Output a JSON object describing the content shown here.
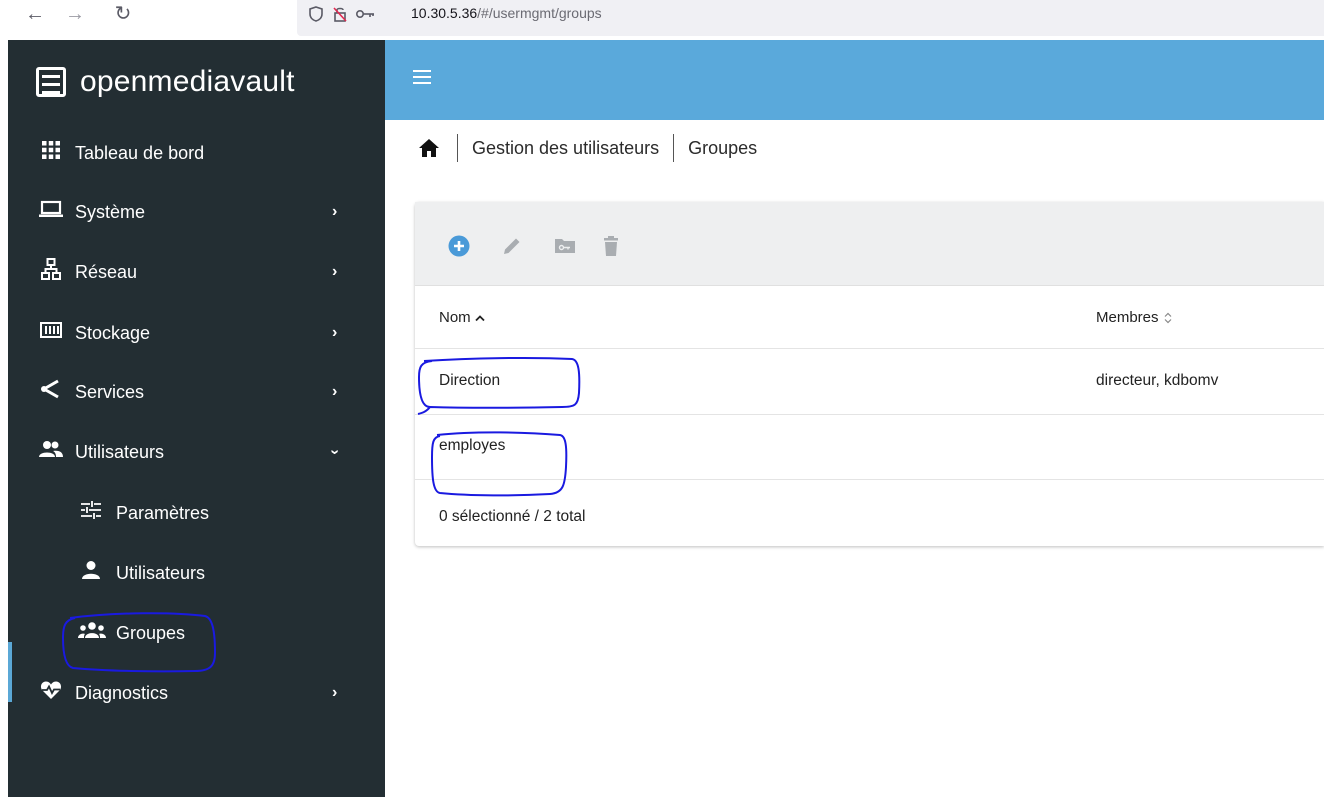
{
  "browser": {
    "url_host": "10.30.5.36",
    "url_path": "/#/usermgmt/groups"
  },
  "app": {
    "brand": "openmediavault"
  },
  "sidebar": {
    "items": [
      {
        "label": "Tableau de bord",
        "icon": "dashboard-icon"
      },
      {
        "label": "Système",
        "icon": "laptop-icon"
      },
      {
        "label": "Réseau",
        "icon": "network-icon"
      },
      {
        "label": "Stockage",
        "icon": "storage-icon"
      },
      {
        "label": "Services",
        "icon": "share-icon"
      },
      {
        "label": "Utilisateurs",
        "icon": "users-icon"
      },
      {
        "label": "Paramètres",
        "icon": "tune-icon"
      },
      {
        "label": "Utilisateurs",
        "icon": "user-icon"
      },
      {
        "label": "Groupes",
        "icon": "groups-icon"
      },
      {
        "label": "Diagnostics",
        "icon": "heart-pulse-icon"
      }
    ],
    "active": "Groupes"
  },
  "breadcrumb": {
    "section": "Gestion des utilisateurs",
    "page": "Groupes"
  },
  "table": {
    "columns": [
      "Nom",
      "Membres"
    ],
    "rows": [
      {
        "nom": "Direction",
        "membres": "directeur, kdbomv"
      },
      {
        "nom": "employes",
        "membres": ""
      }
    ],
    "footer": "0 sélectionné / 2 total"
  },
  "colors": {
    "sidebar_bg": "#232e33",
    "header_bg": "#5aa9db",
    "accent": "#5ba8d6",
    "annotation": "#1a1ae0"
  }
}
